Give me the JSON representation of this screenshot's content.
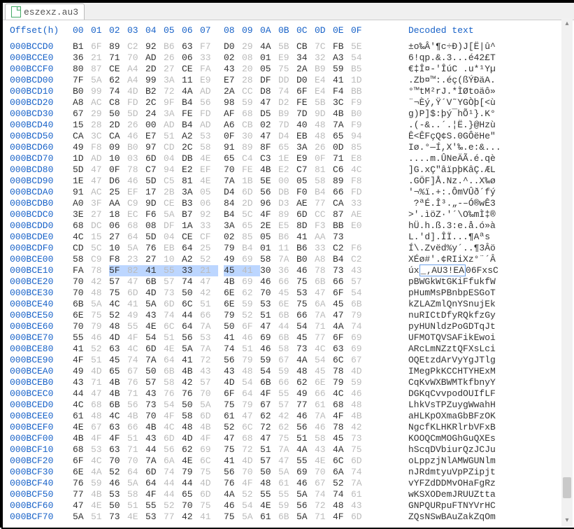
{
  "tab": {
    "label": "eszexz.au3"
  },
  "header": {
    "offset_label": "Offset(h)",
    "columns": [
      "00",
      "01",
      "02",
      "03",
      "04",
      "05",
      "06",
      "07",
      "08",
      "09",
      "0A",
      "0B",
      "0C",
      "0D",
      "0E",
      "0F"
    ],
    "decoded_label": "Decoded text"
  },
  "gray_cols": [
    1,
    3,
    5,
    7,
    9,
    11,
    13,
    15
  ],
  "highlight": {
    "row_offset": "000BCE10",
    "start": 2,
    "end": 9,
    "dec_start": 2,
    "dec_end": 9
  },
  "rows": [
    {
      "offset": "000BCCD0",
      "hex": [
        "B1",
        "6F",
        "89",
        "C2",
        "92",
        "B6",
        "63",
        "F7",
        "D0",
        "29",
        "4A",
        "5B",
        "CB",
        "7C",
        "FB",
        "5E"
      ],
      "dec": "±o‰Â'¶c÷Ð)J[Ë|û^"
    },
    {
      "offset": "000BCCE0",
      "hex": [
        "36",
        "21",
        "71",
        "70",
        "AD",
        "26",
        "06",
        "33",
        "02",
        "08",
        "01",
        "E9",
        "34",
        "32",
        "A3",
        "54"
      ],
      "dec": "6!qp.­&.3...é42£T"
    },
    {
      "offset": "000BCCF0",
      "hex": [
        "80",
        "87",
        "CE",
        "A4",
        "2D",
        "27",
        "CE",
        "FA",
        "43",
        "20",
        "05",
        "75",
        "2A",
        "B9",
        "59",
        "B5"
      ],
      "dec": "€‡Î¤-'ÎúC .u*¹Yµ"
    },
    {
      "offset": "000BCD00",
      "hex": [
        "7F",
        "5A",
        "62",
        "A4",
        "99",
        "3A",
        "11",
        "E9",
        "E7",
        "28",
        "DF",
        "DD",
        "D0",
        "E4",
        "41",
        "1D"
      ],
      "dec": ".Zb¤™:.éç(ßÝÐäA."
    },
    {
      "offset": "000BCD10",
      "hex": [
        "B0",
        "99",
        "74",
        "4D",
        "B2",
        "72",
        "4A",
        "AD",
        "2A",
        "CC",
        "D8",
        "74",
        "6F",
        "E4",
        "F4",
        "BB"
      ],
      "dec": "°™tM²rJ.­*ÌØtoäô»"
    },
    {
      "offset": "000BCD20",
      "hex": [
        "A8",
        "AC",
        "C8",
        "FD",
        "2C",
        "9F",
        "B4",
        "56",
        "98",
        "59",
        "47",
        "D2",
        "FE",
        "5B",
        "3C",
        "F9"
      ],
      "dec": "¨¬Èý,Ÿ´V˜YGÒþ[<ù"
    },
    {
      "offset": "000BCD30",
      "hex": [
        "67",
        "29",
        "50",
        "5D",
        "24",
        "3A",
        "FE",
        "FD",
        "AF",
        "68",
        "D5",
        "B9",
        "7D",
        "9D",
        "4B",
        "B0"
      ],
      "dec": "g)P]$:þý¯hÕ¹}.K°"
    },
    {
      "offset": "000BCD40",
      "hex": [
        "15",
        "28",
        "2D",
        "26",
        "00",
        "AD",
        "B4",
        "AD",
        "A6",
        "CB",
        "02",
        "7D",
        "40",
        "48",
        "7A",
        "F9"
      ],
      "dec": ".(-&..­´.­¦Ë.}@Hzù"
    },
    {
      "offset": "000BCD50",
      "hex": [
        "CA",
        "3C",
        "CA",
        "46",
        "E7",
        "51",
        "A2",
        "53",
        "0F",
        "30",
        "47",
        "D4",
        "EB",
        "48",
        "65",
        "94"
      ],
      "dec": "Ê<ÊFçQ¢S.0GÔëHe\""
    },
    {
      "offset": "000BCD60",
      "hex": [
        "49",
        "F8",
        "09",
        "B0",
        "97",
        "CD",
        "2C",
        "58",
        "91",
        "89",
        "8F",
        "65",
        "3A",
        "26",
        "0D",
        "85"
      ],
      "dec": "Iø.°—Í,X'‰.e:&..."
    },
    {
      "offset": "000BCD70",
      "hex": [
        "1D",
        "AD",
        "10",
        "03",
        "6D",
        "04",
        "DB",
        "4E",
        "65",
        "C4",
        "C3",
        "1E",
        "E9",
        "0F",
        "71",
        "E8"
      ],
      "dec": "..­..m.ÛNeÄÃ.é.qè"
    },
    {
      "offset": "000BCD80",
      "hex": [
        "5D",
        "47",
        "0F",
        "78",
        "C7",
        "94",
        "E2",
        "EF",
        "70",
        "FE",
        "4B",
        "E2",
        "C7",
        "81",
        "C6",
        "4C"
      ],
      "dec": "]G.xÇ\"âïpþKâÇ.ÆL"
    },
    {
      "offset": "000BCD90",
      "hex": [
        "1E",
        "47",
        "D6",
        "46",
        "5D",
        "C5",
        "81",
        "4E",
        "7A",
        "1B",
        "5E",
        "00",
        "05",
        "58",
        "89",
        "F8"
      ],
      "dec": ".GÖF]Å.Nz.^..X‰ø"
    },
    {
      "offset": "000BCDA0",
      "hex": [
        "91",
        "AC",
        "25",
        "EF",
        "17",
        "2B",
        "3A",
        "05",
        "D4",
        "6D",
        "56",
        "DB",
        "F0",
        "B4",
        "66",
        "FD"
      ],
      "dec": "'¬%ï.+:.ÔmVÛð´fý"
    },
    {
      "offset": "000BCDB0",
      "hex": [
        "A0",
        "3F",
        "AA",
        "C9",
        "9D",
        "CE",
        "B3",
        "06",
        "84",
        "2D",
        "96",
        "D3",
        "AE",
        "77",
        "CA",
        "33"
      ],
      "dec": " ?ªÉ.Î³.„-–Ó®wÊ3"
    },
    {
      "offset": "000BCDC0",
      "hex": [
        "3E",
        "27",
        "18",
        "EC",
        "F6",
        "5A",
        "B7",
        "92",
        "B4",
        "5C",
        "4F",
        "89",
        "6D",
        "CC",
        "87",
        "AE"
      ],
      "dec": ">'.ìöZ·'´\\O‰mÌ‡®"
    },
    {
      "offset": "000BCDD0",
      "hex": [
        "68",
        "DC",
        "06",
        "68",
        "08",
        "DF",
        "1A",
        "33",
        "3A",
        "65",
        "2E",
        "E5",
        "8D",
        "F3",
        "BB",
        "E0"
      ],
      "dec": "hÜ.h.ß.3:e.å.ó»à"
    },
    {
      "offset": "000BCDE0",
      "hex": [
        "4C",
        "15",
        "27",
        "64",
        "5D",
        "04",
        "CE",
        "CF",
        "02",
        "85",
        "05",
        "B6",
        "41",
        "AA",
        "73",
        " "
      ],
      "dec": "L.'d].ÎÏ...¶Aªs"
    },
    {
      "offset": "000BCDF0",
      "hex": [
        "CD",
        "5C",
        "10",
        "5A",
        "76",
        "EB",
        "64",
        "25",
        "79",
        "B4",
        "01",
        "11",
        "B6",
        "33",
        "C2",
        "F6"
      ],
      "dec": "Í\\.Zvëd%y´..¶3Âö"
    },
    {
      "offset": "000BCE00",
      "hex": [
        "58",
        "C9",
        "F8",
        "23",
        "27",
        "10",
        "A2",
        "52",
        "49",
        "69",
        "58",
        "7A",
        "B0",
        "A8",
        "B4",
        "C2"
      ],
      "dec": "XÉø#'.¢RIiXz°¨´Â"
    },
    {
      "offset": "000BCE10",
      "hex": [
        "FA",
        "78",
        "5F",
        "82",
        "41",
        "55",
        "33",
        "21",
        "45",
        "41",
        "30",
        "36",
        "46",
        "78",
        "73",
        "43"
      ],
      "dec": "úx_‚AU3!EA06FxsC"
    },
    {
      "offset": "000BCE20",
      "hex": [
        "70",
        "42",
        "57",
        "47",
        "6B",
        "57",
        "74",
        "47",
        "4B",
        "69",
        "46",
        "66",
        "75",
        "6B",
        "66",
        "57"
      ],
      "dec": "pBWGkWtGKiFfukfW"
    },
    {
      "offset": "000BCE30",
      "hex": [
        "70",
        "48",
        "75",
        "6D",
        "4D",
        "73",
        "50",
        "42",
        "6E",
        "62",
        "70",
        "45",
        "53",
        "47",
        "6F",
        "54"
      ],
      "dec": "pHumMsPBnbpESGoT"
    },
    {
      "offset": "000BCE40",
      "hex": [
        "6B",
        "5A",
        "4C",
        "41",
        "5A",
        "6D",
        "6C",
        "51",
        "6E",
        "59",
        "53",
        "6E",
        "75",
        "6A",
        "45",
        "6B"
      ],
      "dec": "kZLAZmlQnYSnujEk"
    },
    {
      "offset": "000BCE50",
      "hex": [
        "6E",
        "75",
        "52",
        "49",
        "43",
        "74",
        "44",
        "66",
        "79",
        "52",
        "51",
        "6B",
        "66",
        "7A",
        "47",
        "79"
      ],
      "dec": "nuRICtDfyRQkfzGy"
    },
    {
      "offset": "000BCE60",
      "hex": [
        "70",
        "79",
        "48",
        "55",
        "4E",
        "6C",
        "64",
        "7A",
        "50",
        "6F",
        "47",
        "44",
        "54",
        "71",
        "4A",
        "74"
      ],
      "dec": "pyHUNldzPoGDTqJt"
    },
    {
      "offset": "000BCE70",
      "hex": [
        "55",
        "46",
        "4D",
        "4F",
        "54",
        "51",
        "56",
        "53",
        "41",
        "46",
        "69",
        "6B",
        "45",
        "77",
        "6F",
        "69"
      ],
      "dec": "UFMOTQVSAFikEwoi"
    },
    {
      "offset": "000BCE80",
      "hex": [
        "41",
        "52",
        "63",
        "4C",
        "6D",
        "4E",
        "5A",
        "7A",
        "74",
        "51",
        "46",
        "58",
        "73",
        "4C",
        "63",
        "69"
      ],
      "dec": "ARcLmNZztQFXsLci"
    },
    {
      "offset": "000BCE90",
      "hex": [
        "4F",
        "51",
        "45",
        "74",
        "7A",
        "64",
        "41",
        "72",
        "56",
        "79",
        "59",
        "67",
        "4A",
        "54",
        "6C",
        "67"
      ],
      "dec": "OQEtzdArVyYgJTlg"
    },
    {
      "offset": "000BCEA0",
      "hex": [
        "49",
        "4D",
        "65",
        "67",
        "50",
        "6B",
        "4B",
        "43",
        "43",
        "48",
        "54",
        "59",
        "48",
        "45",
        "78",
        "4D"
      ],
      "dec": "IMegPkKCCHTYHExM"
    },
    {
      "offset": "000BCEB0",
      "hex": [
        "43",
        "71",
        "4B",
        "76",
        "57",
        "58",
        "42",
        "57",
        "4D",
        "54",
        "6B",
        "66",
        "62",
        "6E",
        "79",
        "59"
      ],
      "dec": "CqKvWXBWMTkfbnyY"
    },
    {
      "offset": "000BCEC0",
      "hex": [
        "44",
        "47",
        "4B",
        "71",
        "43",
        "76",
        "76",
        "70",
        "6F",
        "64",
        "4F",
        "55",
        "49",
        "66",
        "4C",
        "46"
      ],
      "dec": "DGKqCvvpodOUIfLF"
    },
    {
      "offset": "000BCED0",
      "hex": [
        "4C",
        "68",
        "6B",
        "56",
        "73",
        "54",
        "50",
        "5A",
        "75",
        "79",
        "67",
        "57",
        "77",
        "61",
        "68",
        "48"
      ],
      "dec": "LhkVsTPZuygWwahH"
    },
    {
      "offset": "000BCEE0",
      "hex": [
        "61",
        "48",
        "4C",
        "4B",
        "70",
        "4F",
        "58",
        "6D",
        "61",
        "47",
        "62",
        "42",
        "46",
        "7A",
        "4F",
        "4B"
      ],
      "dec": "aHLKpOXmaGbBFzOK"
    },
    {
      "offset": "000BCEF0",
      "hex": [
        "4E",
        "67",
        "63",
        "66",
        "4B",
        "4C",
        "48",
        "4B",
        "52",
        "6C",
        "72",
        "62",
        "56",
        "46",
        "78",
        "42"
      ],
      "dec": "NgcfKLHKRlrbVFxB"
    },
    {
      "offset": "000BCF00",
      "hex": [
        "4B",
        "4F",
        "4F",
        "51",
        "43",
        "6D",
        "4D",
        "4F",
        "47",
        "68",
        "47",
        "75",
        "51",
        "58",
        "45",
        "73"
      ],
      "dec": "KOOQCmMOGhGuQXEs"
    },
    {
      "offset": "000BCF10",
      "hex": [
        "68",
        "53",
        "63",
        "71",
        "44",
        "56",
        "62",
        "69",
        "75",
        "72",
        "51",
        "7A",
        "4A",
        "43",
        "4A",
        "75"
      ],
      "dec": "hScqDVbiurQzJCJu"
    },
    {
      "offset": "000BCF20",
      "hex": [
        "6F",
        "4C",
        "70",
        "70",
        "7A",
        "6A",
        "4E",
        "6C",
        "41",
        "4D",
        "57",
        "47",
        "55",
        "4E",
        "6C",
        "6D"
      ],
      "dec": "oLppzjNlAMWGUNlm"
    },
    {
      "offset": "000BCF30",
      "hex": [
        "6E",
        "4A",
        "52",
        "64",
        "6D",
        "74",
        "79",
        "75",
        "56",
        "70",
        "50",
        "5A",
        "69",
        "70",
        "6A",
        "74"
      ],
      "dec": "nJRdmtyuVpPZipjt"
    },
    {
      "offset": "000BCF40",
      "hex": [
        "76",
        "59",
        "46",
        "5A",
        "64",
        "44",
        "44",
        "4D",
        "76",
        "4F",
        "48",
        "61",
        "46",
        "67",
        "52",
        "7A"
      ],
      "dec": "vYFZdDDMvOHaFgRz"
    },
    {
      "offset": "000BCF50",
      "hex": [
        "77",
        "4B",
        "53",
        "58",
        "4F",
        "44",
        "65",
        "6D",
        "4A",
        "52",
        "55",
        "55",
        "5A",
        "74",
        "74",
        "61"
      ],
      "dec": "wKSXODemJRUUZtta"
    },
    {
      "offset": "000BCF60",
      "hex": [
        "47",
        "4E",
        "50",
        "51",
        "55",
        "52",
        "70",
        "75",
        "46",
        "54",
        "4E",
        "59",
        "56",
        "72",
        "48",
        "43"
      ],
      "dec": "GNPQURpuFTNYVrHC"
    },
    {
      "offset": "000BCF70",
      "hex": [
        "5A",
        "51",
        "73",
        "4E",
        "53",
        "77",
        "42",
        "41",
        "75",
        "5A",
        "61",
        "6B",
        "5A",
        "71",
        "4F",
        "6D"
      ],
      "dec": "ZQsNSwBAuZakZqOm"
    }
  ]
}
